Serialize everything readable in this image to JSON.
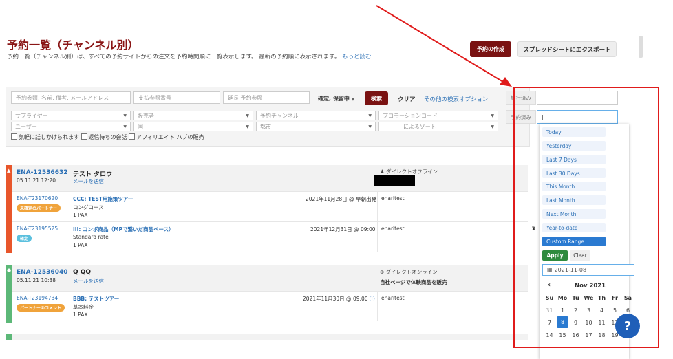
{
  "header": {
    "title": "予約一覧（チャンネル別）",
    "description": "予約一覧（チャンネル別）は、すべての予約サイトからの注文を予約時間順に一覧表示します。 最新の予約順に表示されます。",
    "read_more": "もっと読む",
    "create_button": "予約の作成",
    "export_button": "スプレッドシートにエクスポート"
  },
  "filters": {
    "search_placeholder": "予約参照, 名前, 備考, メールアドレス",
    "payment_ref_placeholder": "支払参照番号",
    "extension_ref_placeholder": "延長 予約参照",
    "status_dropdown": "確定, 保留中",
    "search_button": "検索",
    "clear_button": "クリア",
    "other_options": "その他の検索オプション",
    "supplier": "サプライヤー",
    "seller": "販売者",
    "channel": "予約チャンネル",
    "promo": "プロモーションコード",
    "user": "ユーザー",
    "country": "国",
    "city": "都市",
    "sort": "によるソート",
    "checkbox1": "気軽に話しかけられます",
    "checkbox2": "返信待ちの会話",
    "checkbox3": "アフィリエイト ハブの販売",
    "travel_done_label": "旅行済み",
    "booked_label": "予約済み"
  },
  "orders": [
    {
      "id": "ENA-12536632",
      "datetime": "05.11'21 12:20",
      "customer": "テスト タロウ",
      "email_link": "メールを送信",
      "channel": "ダイレクトオフライン",
      "stripe_color": "#e8562b",
      "items": [
        {
          "ref": "ENA-T23170620",
          "badge": "未確定のパートナー",
          "badge_color": "#f0a33b",
          "product": "CCC: TEST用施策ツアー",
          "rate": "ロングコース",
          "pax": "1 PAX",
          "date": "2021年11月28日 @ 早朝出発",
          "user": "enaritest"
        },
        {
          "ref": "ENA-T23195525",
          "badge": "確定",
          "badge_color": "#5bc0de",
          "product": "III: コンボ商品（MPで繋いだ商品ベース）",
          "rate": "Standard rate",
          "pax": "1 PAX",
          "date": "2021年12月31日 @ 09:00",
          "user": "enaritest"
        }
      ]
    },
    {
      "id": "ENA-12536040",
      "datetime": "05.11'21 10:38",
      "customer": "Q QQ",
      "email_link": "メールを送信",
      "channel": "ダイレクトオンライン",
      "channel_note": "自社ページで体験商品を販売",
      "stripe_color": "#5cb878",
      "items": [
        {
          "ref": "ENA-T23194734",
          "badge": "パートナーのコメント",
          "badge_color": "#f0a33b",
          "product": "BBB: テストツアー",
          "rate": "基本料金",
          "pax": "1 PAX",
          "date": "2021年11月30日 @ 09:00",
          "user": "enaritest"
        }
      ]
    }
  ],
  "datepicker": {
    "ranges": [
      "Today",
      "Yesterday",
      "Last 7 Days",
      "Last 30 Days",
      "This Month",
      "Last Month",
      "Next Month",
      "Year-to-date",
      "Custom Range"
    ],
    "active_range": "Custom Range",
    "apply": "Apply",
    "clear": "Clear",
    "start_date": "2021-11-08",
    "month": "Nov 2021",
    "weekdays": [
      "Su",
      "Mo",
      "Tu",
      "We",
      "Th",
      "Fr",
      "Sa"
    ],
    "week1": [
      "31",
      "1",
      "2",
      "3",
      "4",
      "5",
      "6"
    ],
    "week2": [
      "7",
      "8",
      "9",
      "10",
      "11",
      "12",
      "13"
    ],
    "week3": [
      "14",
      "15",
      "16",
      "17",
      "18",
      "19",
      "20"
    ],
    "selected_day": "8"
  },
  "help_icon": "?",
  "colors": {
    "brand": "#7a1212",
    "link": "#2a6fb5",
    "annotation": "#e01b1b"
  }
}
